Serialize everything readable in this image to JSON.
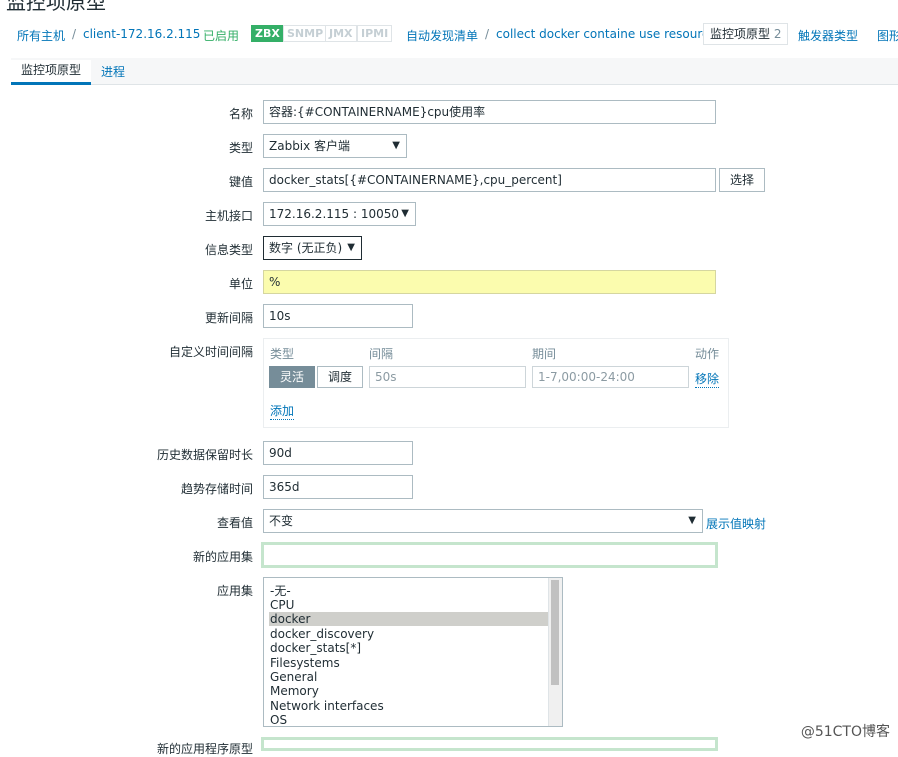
{
  "page_title": "监控项原型",
  "breadcrumb": {
    "all_hosts": "所有主机",
    "host": "client-172.16.2.115",
    "status": "已启用",
    "tags": [
      "ZBX",
      "SNMP",
      "JMX",
      "IPMI"
    ],
    "discovery_list": "自动发现清单",
    "discovery_rule": "collect docker containe use resource",
    "item_prototypes": "监控项原型",
    "item_prototypes_count": "2",
    "trigger_types": "触发器类型",
    "graphs": "图形"
  },
  "tabs": {
    "item_prototype": "监控项原型",
    "process": "进程"
  },
  "form": {
    "name_label": "名称",
    "name_value": "容器:{#CONTAINERNAME}cpu使用率",
    "type_label": "类型",
    "type_value": "Zabbix 客户端",
    "key_label": "键值",
    "key_value": "docker_stats[{#CONTAINERNAME},cpu_percent]",
    "select_btn": "选择",
    "interface_label": "主机接口",
    "interface_value": "172.16.2.115 : 10050",
    "info_type_label": "信息类型",
    "info_type_value": "数字 (无正负)",
    "units_label": "单位",
    "units_value": "%",
    "update_label": "更新间隔",
    "update_value": "10s",
    "custom_label": "自定义时间间隔",
    "custom": {
      "col_type": "类型",
      "col_interval": "间隔",
      "col_period": "期间",
      "col_action": "动作",
      "flexible": "灵活",
      "scheduling": "调度",
      "interval_ph": "50s",
      "period_ph": "1-7,00:00-24:00",
      "remove": "移除",
      "add": "添加"
    },
    "history_label": "历史数据保留时长",
    "history_value": "90d",
    "trends_label": "趋势存储时间",
    "trends_value": "365d",
    "valuemap_label": "查看值",
    "valuemap_value": "不变",
    "valuemap_link": "展示值映射",
    "new_app_label": "新的应用集",
    "new_app_value": "",
    "apps_label": "应用集",
    "apps": [
      "-无-",
      "CPU",
      "docker",
      "docker_discovery",
      "docker_stats[*]",
      "Filesystems",
      "General",
      "Memory",
      "Network interfaces",
      "OS"
    ],
    "apps_selected": "docker",
    "new_app_proto_label": "新的应用程序原型"
  },
  "watermark": "@51CTO博客",
  "icons": {
    "dropdown": "chevron-down-icon"
  }
}
